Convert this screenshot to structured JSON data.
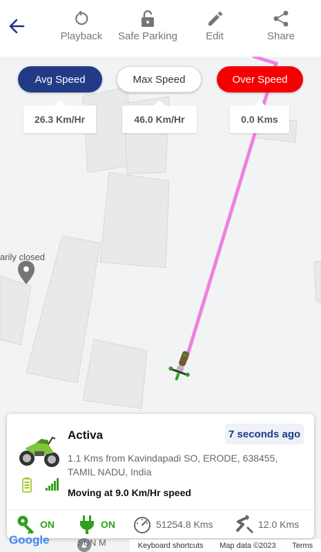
{
  "toolbar": {
    "playback": "Playback",
    "safe_parking": "Safe Parking",
    "edit": "Edit",
    "share": "Share"
  },
  "speeds": {
    "avg_label": "Avg Speed",
    "max_label": "Max Speed",
    "over_label": "Over Speed",
    "avg_value": "26.3 Km/Hr",
    "max_value": "46.0 Km/Hr",
    "over_value": "0.0 Kms"
  },
  "map": {
    "poi_label": "arily closed",
    "bottom_poi": "SUN M",
    "google": "Google",
    "keyboard": "Keyboard shortcuts",
    "map_data": "Map data ©2023",
    "terms": "Terms",
    "route_color": "#f080e0"
  },
  "vehicle": {
    "name": "Activa",
    "last_update": "7 seconds ago",
    "address": "1.1 Kms from Kavindapadi SO, ERODE, 638455, TAMIL NADU, India",
    "status": "Moving at 9.0 Km/Hr speed",
    "ignition": "ON",
    "power": "ON",
    "odometer": "51254.8 Kms",
    "distance": "12.0 Kms"
  },
  "colors": {
    "avg": "#233b86",
    "over": "#f40000",
    "green": "#2ea01b"
  }
}
